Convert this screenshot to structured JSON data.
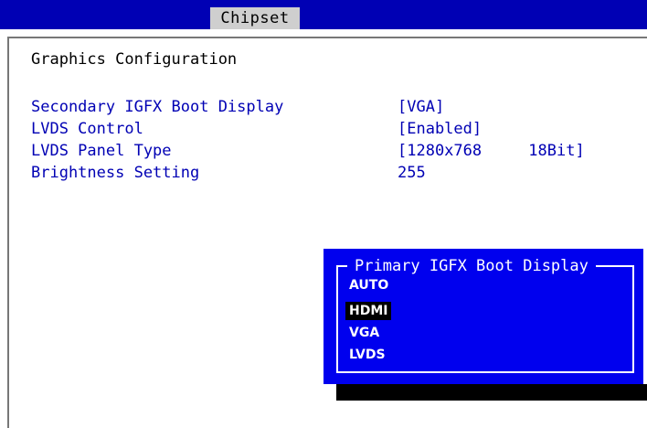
{
  "header": {
    "tab_label": "Chipset"
  },
  "section": {
    "title": "Graphics Configuration"
  },
  "settings": [
    {
      "label": "Primary IGFX Boot Display",
      "value": "[HDMI]"
    },
    {
      "label": "Secondary IGFX Boot Display",
      "value": "[VGA]"
    },
    {
      "label": "LVDS Control",
      "value": "[Enabled]"
    },
    {
      "label": "LVDS Panel Type",
      "value": "[1280x768     18Bit]"
    },
    {
      "label": "Brightness Setting",
      "value": "255"
    }
  ],
  "popup": {
    "title": "Primary IGFX Boot Display",
    "options": [
      "AUTO",
      "HDMI",
      "VGA",
      "LVDS"
    ],
    "selected": "HDMI"
  },
  "colors": {
    "header_bg": "#0000b4",
    "tab_bg": "#cfcfcf",
    "item_text": "#0000b4",
    "popup_bg": "#0000ee",
    "highlight_bg": "#000000"
  }
}
